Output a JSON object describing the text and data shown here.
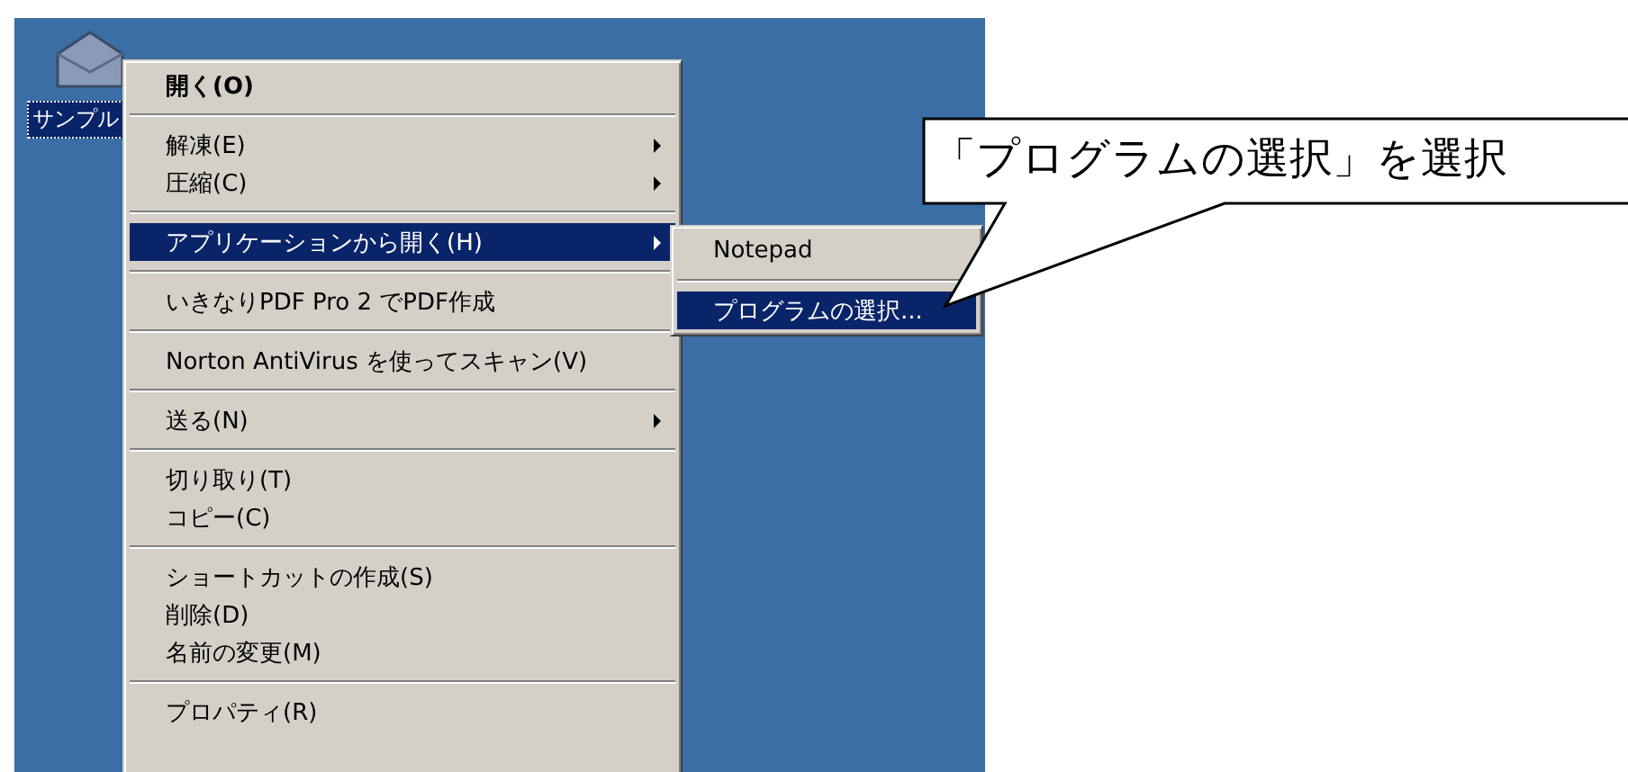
{
  "desktop": {
    "icon": {
      "label": "サンプル",
      "selected": true
    }
  },
  "context_menu": {
    "groups": [
      {
        "items": [
          {
            "label": "開く(O)",
            "default": true,
            "has_submenu": false,
            "selected": false
          }
        ]
      },
      {
        "items": [
          {
            "label": "解凍(E)",
            "default": false,
            "has_submenu": true,
            "selected": false
          },
          {
            "label": "圧縮(C)",
            "default": false,
            "has_submenu": true,
            "selected": false
          }
        ]
      },
      {
        "items": [
          {
            "label": "アプリケーションから開く(H)",
            "default": false,
            "has_submenu": true,
            "selected": true
          }
        ]
      },
      {
        "items": [
          {
            "label": "いきなりPDF Pro 2 でPDF作成",
            "default": false,
            "has_submenu": false,
            "selected": false
          }
        ]
      },
      {
        "items": [
          {
            "label": "Norton AntiVirus を使ってスキャン(V)",
            "default": false,
            "has_submenu": false,
            "selected": false
          }
        ]
      },
      {
        "items": [
          {
            "label": "送る(N)",
            "default": false,
            "has_submenu": true,
            "selected": false
          }
        ]
      },
      {
        "items": [
          {
            "label": "切り取り(T)",
            "default": false,
            "has_submenu": false,
            "selected": false
          },
          {
            "label": "コピー(C)",
            "default": false,
            "has_submenu": false,
            "selected": false
          }
        ]
      },
      {
        "items": [
          {
            "label": "ショートカットの作成(S)",
            "default": false,
            "has_submenu": false,
            "selected": false
          },
          {
            "label": "削除(D)",
            "default": false,
            "has_submenu": false,
            "selected": false
          },
          {
            "label": "名前の変更(M)",
            "default": false,
            "has_submenu": false,
            "selected": false
          }
        ]
      },
      {
        "items": [
          {
            "label": "プロパティ(R)",
            "default": false,
            "has_submenu": false,
            "selected": false
          }
        ]
      }
    ]
  },
  "submenu": {
    "groups": [
      {
        "items": [
          {
            "label": "Notepad",
            "selected": false
          }
        ]
      },
      {
        "items": [
          {
            "label": "プログラムの選択...",
            "selected": true
          }
        ]
      }
    ]
  },
  "callout": {
    "text": "「プログラムの選択」を選択"
  }
}
